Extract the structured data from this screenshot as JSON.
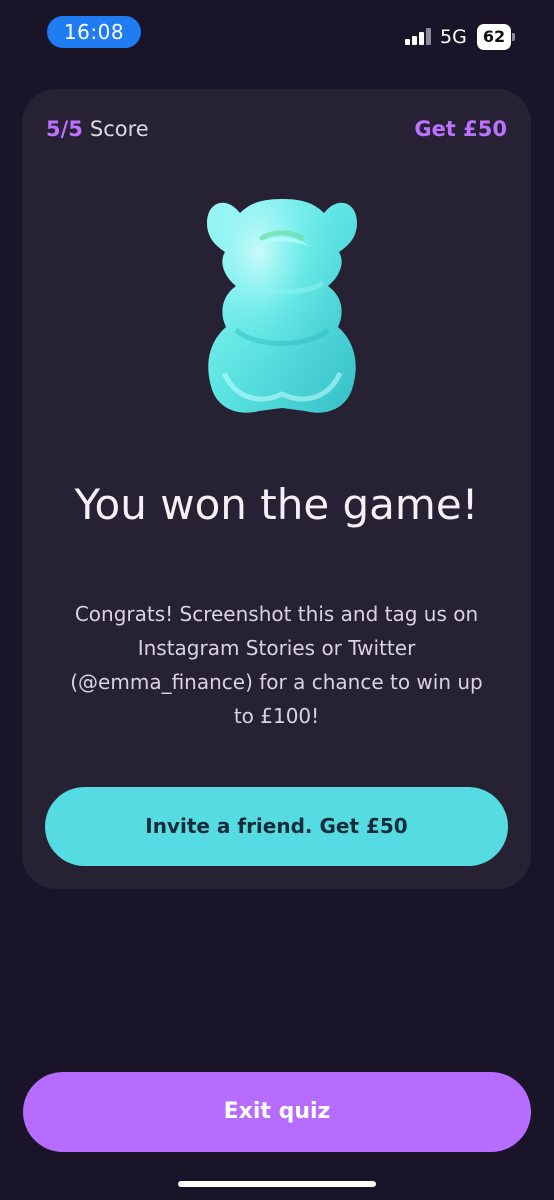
{
  "status_bar": {
    "time": "16:08",
    "network": "5G",
    "battery": "62",
    "colors": {
      "time_pill": "#1f7cf1"
    }
  },
  "quiz": {
    "score_value": "5/5",
    "score_label": "Score",
    "reward": "Get £50",
    "title": "You won the game!",
    "message": "Congrats! Screenshot this and tag us on Instagram Stories or Twitter (@emma_finance) for a chance to win up to £100!",
    "invite_button": "Invite a friend. Get £50",
    "exit_button": "Exit quiz",
    "illustration": "gummy-bear-icon"
  },
  "colors": {
    "background": "#1a1429",
    "card": "#262234",
    "accent": "#bd72ff",
    "invite_button": "#55dbe1",
    "exit_button": "#b56cff"
  }
}
